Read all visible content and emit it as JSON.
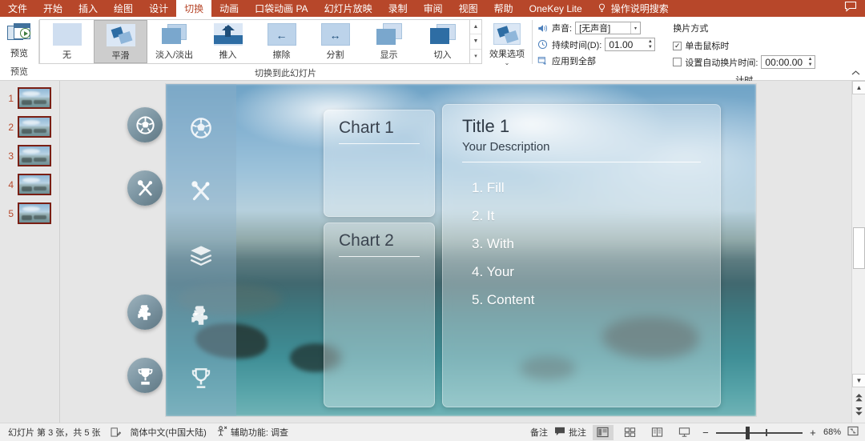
{
  "menu": {
    "items": [
      {
        "label": "文件",
        "active": false
      },
      {
        "label": "开始",
        "active": false
      },
      {
        "label": "插入",
        "active": false
      },
      {
        "label": "绘图",
        "active": false
      },
      {
        "label": "设计",
        "active": false
      },
      {
        "label": "切换",
        "active": true
      },
      {
        "label": "动画",
        "active": false
      },
      {
        "label": "口袋动画 PA",
        "active": false
      },
      {
        "label": "幻灯片放映",
        "active": false
      },
      {
        "label": "录制",
        "active": false
      },
      {
        "label": "审阅",
        "active": false
      },
      {
        "label": "视图",
        "active": false
      },
      {
        "label": "帮助",
        "active": false
      },
      {
        "label": "OneKey Lite",
        "active": false
      }
    ],
    "search_label": "操作说明搜索",
    "search_icon": "lightbulb-icon",
    "comment_icon": "comment-icon",
    "bar_color": "#b7472a"
  },
  "ribbon": {
    "preview": {
      "button_label": "预览",
      "group_label": "预览",
      "icon": "preview-play-icon"
    },
    "gallery": {
      "group_label": "切换到此幻灯片",
      "items": [
        {
          "label": "无",
          "icon": "none-thumb",
          "selected": false
        },
        {
          "label": "平滑",
          "icon": "morph-thumb",
          "selected": true
        },
        {
          "label": "淡入/淡出",
          "icon": "fade-thumb",
          "selected": false
        },
        {
          "label": "推入",
          "icon": "push-thumb",
          "selected": false
        },
        {
          "label": "擦除",
          "icon": "wipe-thumb",
          "selected": false
        },
        {
          "label": "分割",
          "icon": "split-thumb",
          "selected": false
        },
        {
          "label": "显示",
          "icon": "reveal-thumb",
          "selected": false
        },
        {
          "label": "切入",
          "icon": "cut-thumb",
          "selected": false
        }
      ],
      "scroll_up": "▲",
      "scroll_down": "▼",
      "scroll_more": "▾"
    },
    "effect_options": {
      "label": "效果选项",
      "caret": "⌄",
      "icon": "morph-effect-icon"
    },
    "timing": {
      "group_label": "计时",
      "sound_label": "声音:",
      "sound_value": "[无声音]",
      "sound_icon": "speaker-icon",
      "duration_label": "持续时间(D):",
      "duration_value": "01.00",
      "duration_icon": "clock-icon",
      "apply_all_label": "应用到全部",
      "apply_all_icon": "apply-all-icon",
      "advance_title": "换片方式",
      "on_click_label": "单击鼠标时",
      "on_click_checked": true,
      "auto_label": "设置自动换片时间:",
      "auto_checked": false,
      "auto_value": "00:00.00"
    },
    "collapse_icon": "chevron-up-icon"
  },
  "thumbnails": {
    "slides": [
      {
        "number": "1",
        "selected": false
      },
      {
        "number": "2",
        "selected": false
      },
      {
        "number": "3",
        "selected": true
      },
      {
        "number": "4",
        "selected": false
      },
      {
        "number": "5",
        "selected": false
      }
    ]
  },
  "slide": {
    "icons": [
      {
        "name": "soccer-ball-icon"
      },
      {
        "name": "tools-icon"
      },
      {
        "name": "layers-icon"
      },
      {
        "name": "puzzle-piece-icon"
      },
      {
        "name": "trophy-icon"
      }
    ],
    "chart1": {
      "title": "Chart 1"
    },
    "chart2": {
      "title": "Chart 2"
    },
    "main": {
      "title": "Title 1",
      "subtitle": "Your Description",
      "list": [
        "1. Fill",
        "2. It",
        "3. With",
        "4. Your",
        "5. Content"
      ]
    }
  },
  "scrollbar": {
    "up_icon": "▲",
    "down_icon": "▼",
    "prev_slide_icon": "⏫",
    "next_slide_icon": "⏬",
    "menu_icon": "▾"
  },
  "status": {
    "slide_counter": "幻灯片 第 3 张，共 5 张",
    "notes_flag_icon": "notes-page-icon",
    "language": "简体中文(中国大陆)",
    "accessibility_icon": "accessibility-icon",
    "accessibility": "辅助功能: 调查",
    "notes_label": "备注",
    "notes_icon": "notes-icon",
    "comments_label": "批注",
    "comments_icon": "comment-balloon-icon",
    "views": [
      {
        "name": "normal-view",
        "icon": "normal-view-icon",
        "active": true
      },
      {
        "name": "slide-sorter-view",
        "icon": "sorter-view-icon",
        "active": false
      },
      {
        "name": "reading-view",
        "icon": "reading-view-icon",
        "active": false
      },
      {
        "name": "slideshow-view",
        "icon": "slideshow-icon",
        "active": false
      }
    ],
    "zoom_out": "−",
    "zoom_in": "+",
    "zoom_level": "68%",
    "fit_icon": "fit-to-window-icon"
  }
}
